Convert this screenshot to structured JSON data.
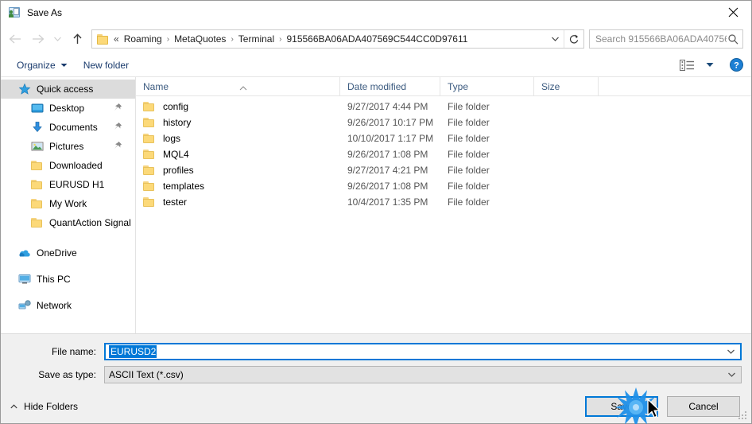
{
  "window": {
    "title": "Save As",
    "title_icon": "save-as-icon",
    "close_icon": "close-icon"
  },
  "nav": {
    "back_icon": "back-arrow-icon",
    "forward_icon": "forward-arrow-icon",
    "recent_icon": "chevron-down-icon",
    "up_icon": "up-arrow-icon",
    "folder_icon": "folder-icon",
    "breadcrumb_prefix": "«",
    "breadcrumbs": [
      "Roaming",
      "MetaQuotes",
      "Terminal",
      "915566BA06ADA407569C544CC0D97611"
    ],
    "separator": "›",
    "dropdown_icon": "chevron-down-icon",
    "refresh_icon": "refresh-icon"
  },
  "search": {
    "placeholder": "Search 915566BA06ADA40756...",
    "icon": "search-icon"
  },
  "toolbar": {
    "organize_label": "Organize",
    "organize_caret_icon": "caret-down-icon",
    "new_folder_label": "New folder",
    "view_icon": "view-list-icon",
    "view_caret_icon": "caret-down-icon",
    "help_icon": "help-icon",
    "help_label": "?"
  },
  "sidebar": {
    "items": [
      {
        "label": "Quick access",
        "icon": "star-icon",
        "selected": true,
        "indent": false,
        "pinned": false
      },
      {
        "label": "Desktop",
        "icon": "desktop-icon",
        "selected": false,
        "indent": true,
        "pinned": true
      },
      {
        "label": "Documents",
        "icon": "documents-icon",
        "selected": false,
        "indent": true,
        "pinned": true
      },
      {
        "label": "Pictures",
        "icon": "pictures-icon",
        "selected": false,
        "indent": true,
        "pinned": true
      },
      {
        "label": "Downloaded",
        "icon": "folder-icon",
        "selected": false,
        "indent": true,
        "pinned": false
      },
      {
        "label": "EURUSD H1",
        "icon": "folder-icon",
        "selected": false,
        "indent": true,
        "pinned": false
      },
      {
        "label": "My Work",
        "icon": "folder-icon",
        "selected": false,
        "indent": true,
        "pinned": false
      },
      {
        "label": "QuantAction Signal",
        "icon": "folder-icon",
        "selected": false,
        "indent": true,
        "pinned": false
      },
      {
        "label": "OneDrive",
        "icon": "onedrive-icon",
        "selected": false,
        "indent": false,
        "pinned": false,
        "spacer_before": true
      },
      {
        "label": "This PC",
        "icon": "thispc-icon",
        "selected": false,
        "indent": false,
        "pinned": false,
        "spacer_before": true
      },
      {
        "label": "Network",
        "icon": "network-icon",
        "selected": false,
        "indent": false,
        "pinned": false,
        "spacer_before": true
      }
    ]
  },
  "filelist": {
    "columns": [
      "Name",
      "Date modified",
      "Type",
      "Size"
    ],
    "sort_column": "Name",
    "sort_direction": "ascending",
    "rows": [
      {
        "name": "config",
        "date": "9/27/2017 4:44 PM",
        "type": "File folder",
        "size": ""
      },
      {
        "name": "history",
        "date": "9/26/2017 10:17 PM",
        "type": "File folder",
        "size": ""
      },
      {
        "name": "logs",
        "date": "10/10/2017 1:17 PM",
        "type": "File folder",
        "size": ""
      },
      {
        "name": "MQL4",
        "date": "9/26/2017 1:08 PM",
        "type": "File folder",
        "size": ""
      },
      {
        "name": "profiles",
        "date": "9/27/2017 4:21 PM",
        "type": "File folder",
        "size": ""
      },
      {
        "name": "templates",
        "date": "9/26/2017 1:08 PM",
        "type": "File folder",
        "size": ""
      },
      {
        "name": "tester",
        "date": "10/4/2017 1:35 PM",
        "type": "File folder",
        "size": ""
      }
    ]
  },
  "form": {
    "filename_label": "File name:",
    "filename_value": "EURUSD2",
    "filename_selected": true,
    "savetype_label": "Save as type:",
    "savetype_value": "ASCII Text (*.csv)",
    "caret_icon": "chevron-down-icon"
  },
  "footer": {
    "hide_folders_label": "Hide Folders",
    "hide_folders_icon": "caret-up-icon",
    "save_label": "Save",
    "cancel_label": "Cancel",
    "resize_grip_icon": "resize-grip-icon"
  },
  "pointer": {
    "click_effect_icon": "click-burst-icon",
    "cursor_icon": "arrow-cursor-icon",
    "accent_color": "#0078d7"
  }
}
